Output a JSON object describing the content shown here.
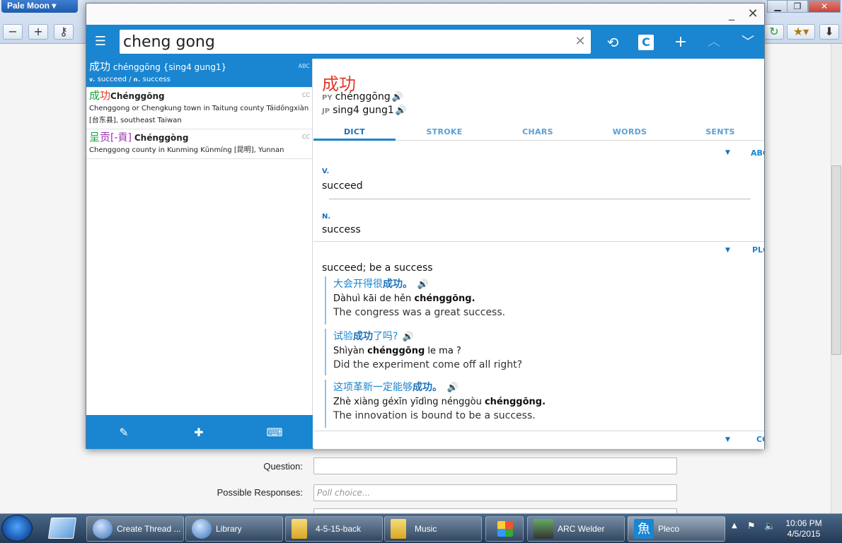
{
  "browser": {
    "app_name": "Pale Moon",
    "form": {
      "question_label": "Question:",
      "responses_label": "Possible Responses:",
      "responses_placeholder": "Poll choice..."
    }
  },
  "pleco": {
    "search_value": "cheng gong",
    "tabs": [
      "DICT",
      "STROKE",
      "CHARS",
      "WORDS",
      "SENTS"
    ],
    "results": [
      {
        "hz": "成功",
        "py": "chénggōng {sing4 gung1}",
        "src": "ABC",
        "def_pos1": "v.",
        "def1": "succeed",
        "sep": "/",
        "def_pos2": "n.",
        "def2": "success"
      },
      {
        "hz": "成功",
        "py": "Chénggōng",
        "src": "CC",
        "def1": "Chenggong or Chengkung town in Taitung county Táidōngxiàn",
        "def2": "[台东县], southeast Taiwan"
      },
      {
        "hz_a": "呈贡",
        "hz_b": "[-貢]",
        "py": "Chénggòng",
        "src": "CC",
        "def1": "Chenggong county in Kunming Kūnmíng [昆明], Yunnan"
      }
    ],
    "detail": {
      "headword": "成功",
      "py_label": "PY",
      "py": "chénggōng",
      "jp_label": "JP",
      "jp": "sing4 gung1",
      "dict1": "ABC",
      "pos_v": "V.",
      "def_v": "succeed",
      "pos_n": "N.",
      "def_n": "success",
      "dict2": "PLC",
      "plc_def": "succeed; be a success",
      "examples": [
        {
          "cn_pre": "大会开得很",
          "cn_hl": "成功。",
          "cn_post": "",
          "py_pre": "Dàhuì kāi de hěn ",
          "py_hl": "chénggōng.",
          "py_post": "",
          "en": "The congress was a great success."
        },
        {
          "cn_pre": "试验",
          "cn_hl": "成功",
          "cn_post": "了吗?",
          "py_pre": "Shìyàn ",
          "py_hl": "chénggōng",
          "py_post": " le ma ?",
          "en": "Did the experiment come off all right?"
        },
        {
          "cn_pre": "这项革新一定能够",
          "cn_hl": "成功。",
          "cn_post": "",
          "py_pre": "Zhè xiàng géxīn yīdìng nénggòu ",
          "py_hl": "chénggōng.",
          "py_post": "",
          "en": "The innovation is bound to be a success."
        }
      ],
      "dict3": "CC"
    }
  },
  "taskbar": {
    "items": [
      "Create Thread ...",
      "Library",
      "4-5-15-back",
      "Music",
      "ARC Welder",
      "Pleco"
    ],
    "time": "10:06 PM",
    "date": "4/5/2015"
  },
  "colors": {
    "accent": "#1a85d0",
    "hanzi_red": "#e23b2a",
    "hanzi_green": "#1aa33c",
    "hanzi_purple": "#9c2fb1"
  },
  "icons": [
    "menu-icon",
    "history-icon",
    "plus-icon",
    "chevron-up-icon",
    "chevron-down-icon",
    "close-icon",
    "minimize-icon",
    "speaker-icon",
    "pen-icon",
    "puzzle-icon",
    "keyboard-icon"
  ]
}
